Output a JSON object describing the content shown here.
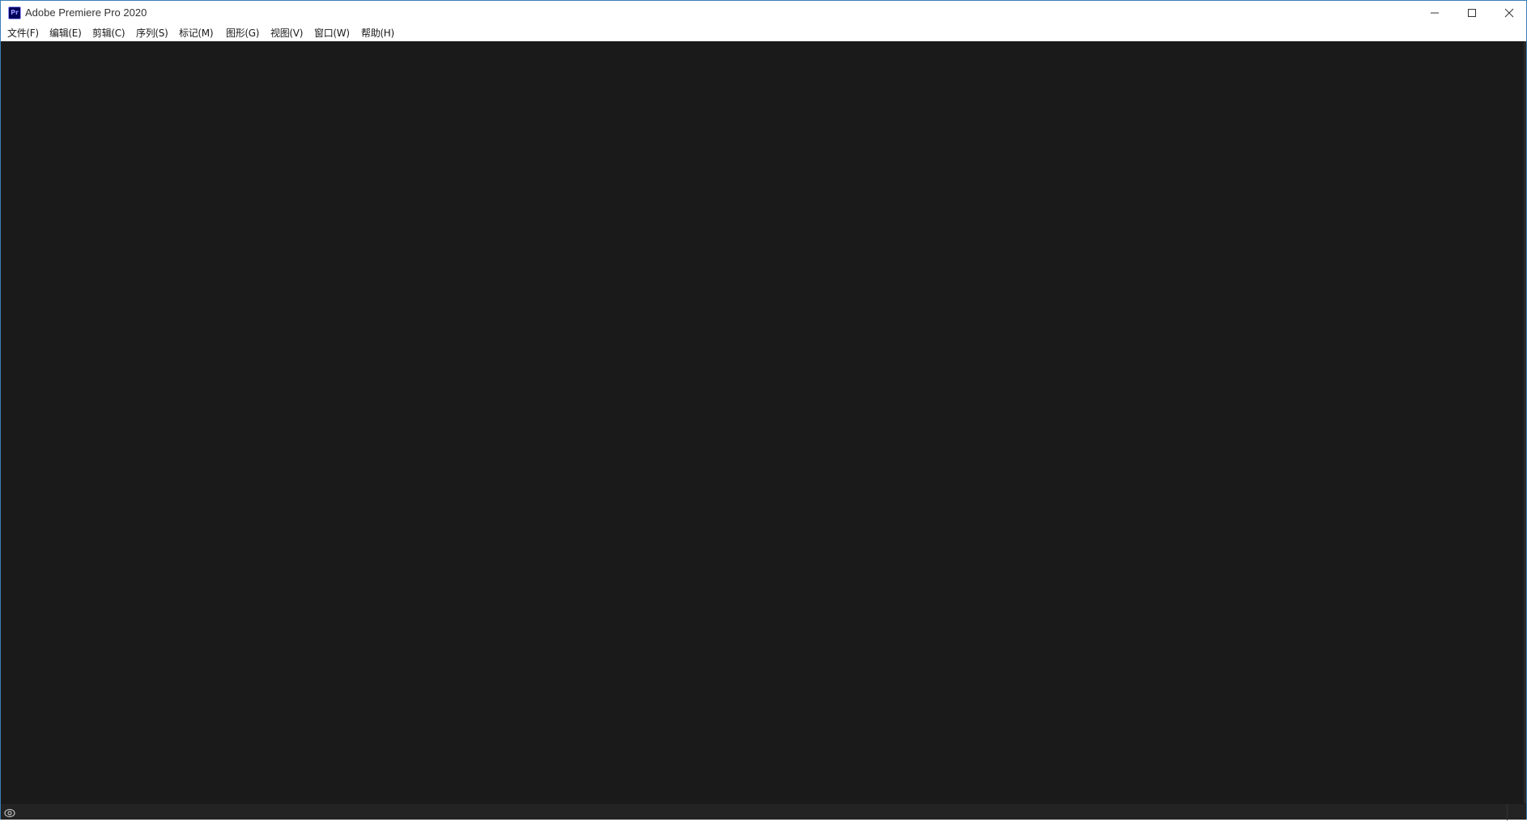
{
  "window": {
    "title": "Adobe Premiere Pro 2020",
    "app_icon_text": "Pr",
    "controls": {
      "minimize": "minimize-icon",
      "maximize": "maximize-icon",
      "close": "close-icon"
    }
  },
  "menu": {
    "items": [
      {
        "label": "文件(F)"
      },
      {
        "label": "编辑(E)"
      },
      {
        "label": "剪辑(C)"
      },
      {
        "label": "序列(S)"
      },
      {
        "label": "标记(M)"
      },
      {
        "label": "图形(G)"
      },
      {
        "label": "视图(V)"
      },
      {
        "label": "窗口(W)"
      },
      {
        "label": "帮助(H)"
      }
    ]
  },
  "statusbar": {
    "icon": "creative-cloud-sync-icon"
  },
  "colors": {
    "workspace_bg": "#1a1a1a",
    "statusbar_bg": "#232323",
    "window_border": "#3a7fb8",
    "app_icon_bg": "#00005b",
    "app_icon_fg": "#9999ff"
  }
}
